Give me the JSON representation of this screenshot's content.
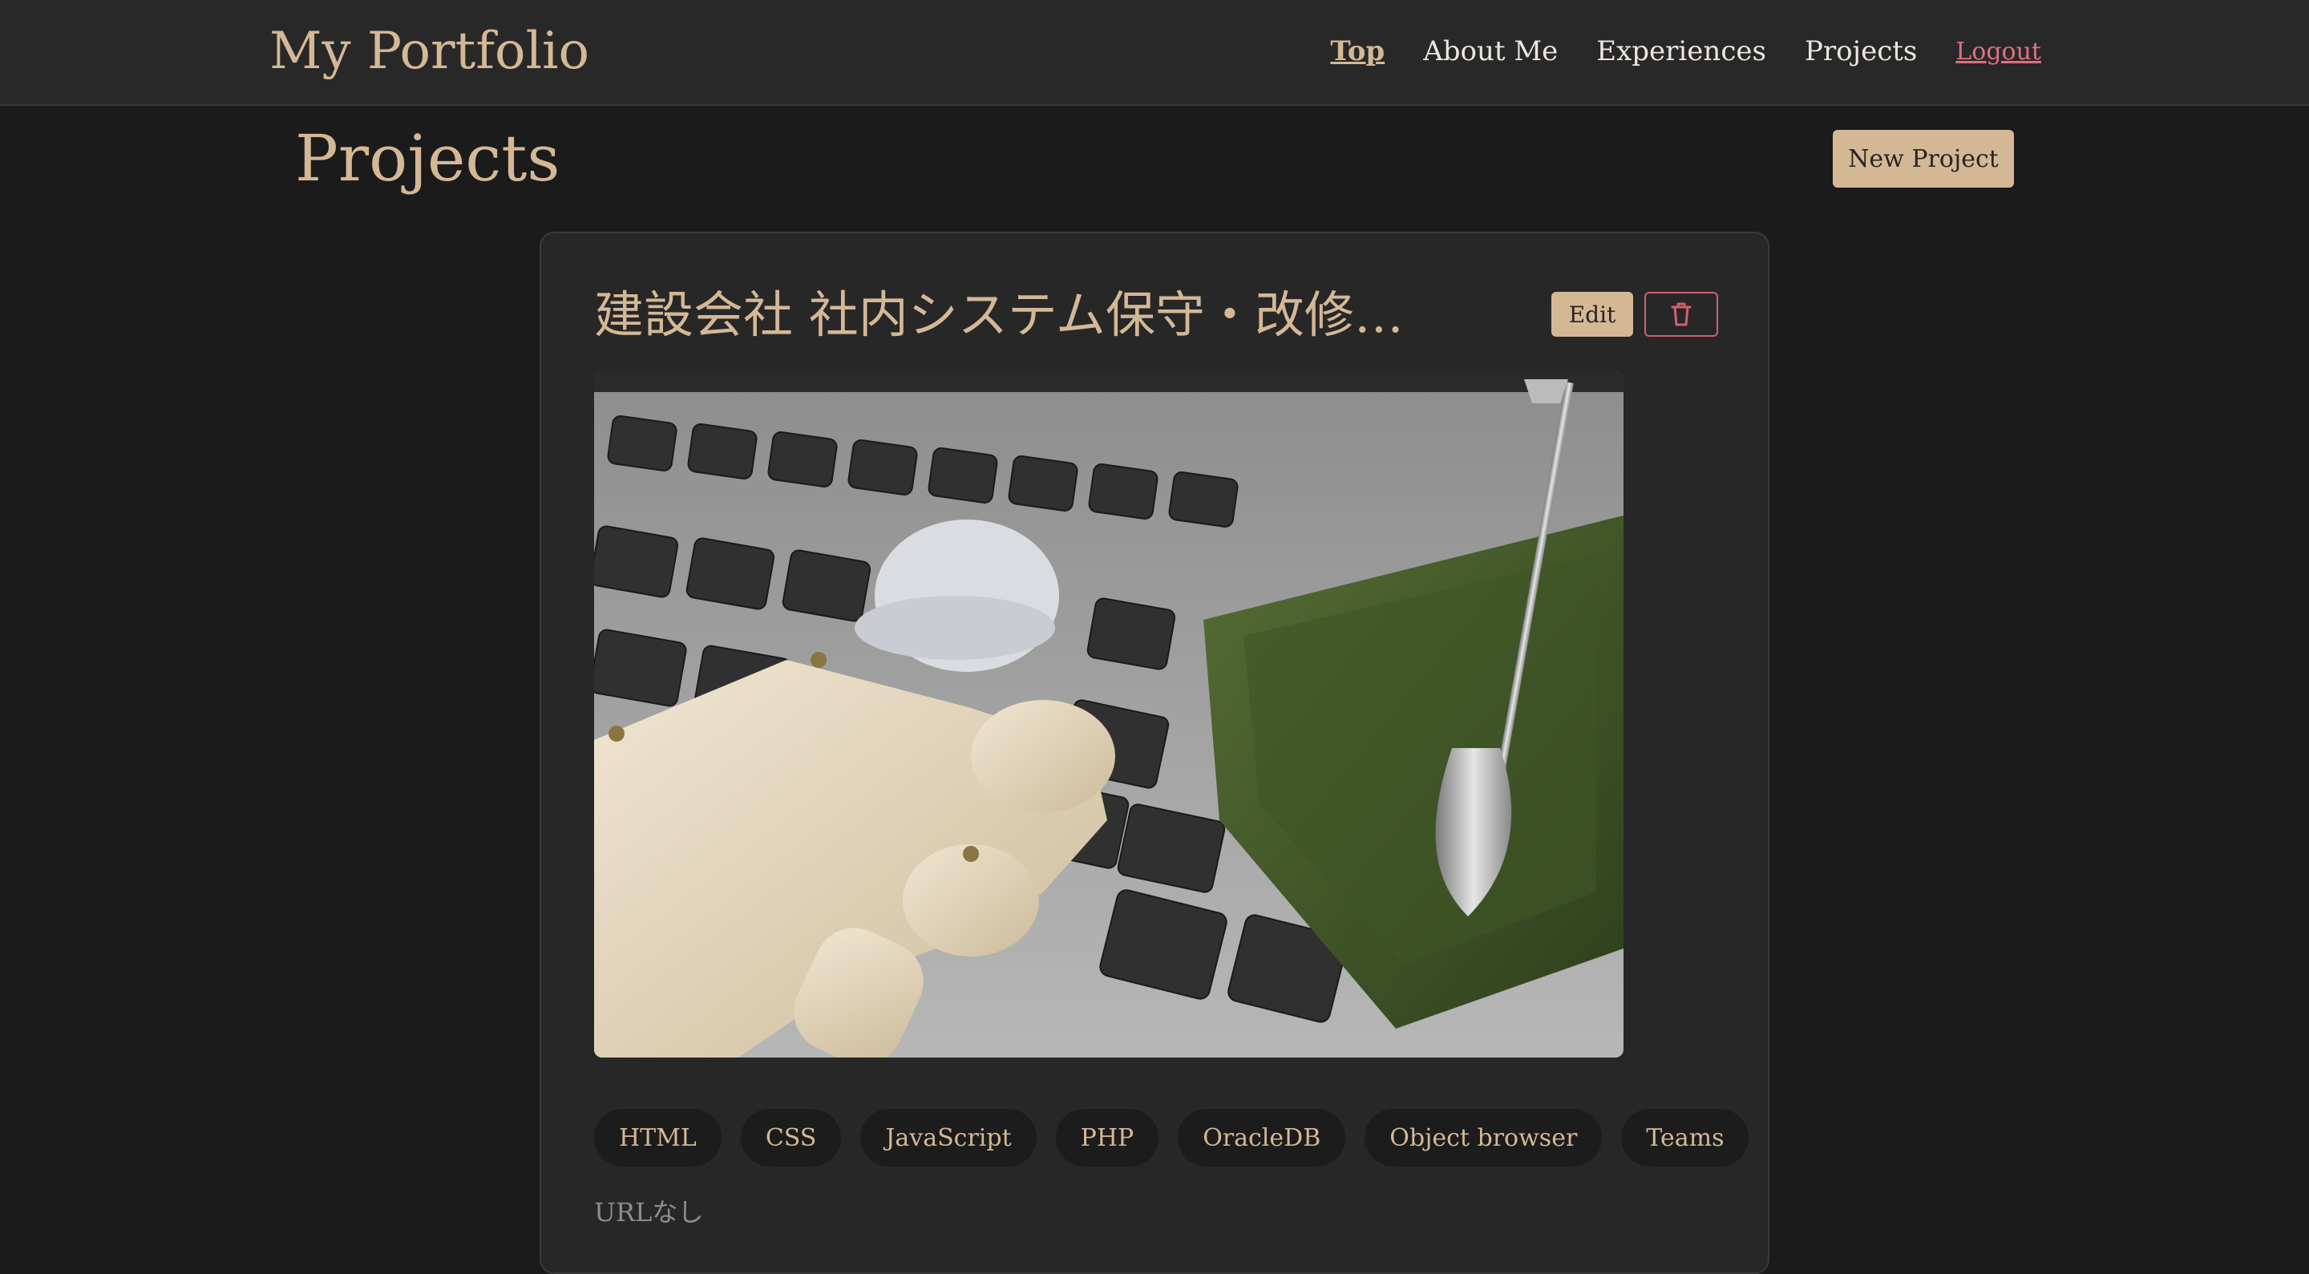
{
  "nav": {
    "brand": "My Portfolio",
    "links": [
      {
        "label": "Top",
        "active": true
      },
      {
        "label": "About Me"
      },
      {
        "label": "Experiences"
      },
      {
        "label": "Projects"
      },
      {
        "label": "Logout"
      }
    ]
  },
  "page": {
    "title": "Projects",
    "new_project_label": "New Project"
  },
  "project": {
    "title": "建設会社 社内システム保守・改修…",
    "edit_label": "Edit",
    "delete_icon": "trash-icon",
    "image_icon": "project-photo",
    "tags": [
      "HTML",
      "CSS",
      "JavaScript",
      "PHP",
      "OracleDB",
      "Object browser",
      "Teams"
    ],
    "url_text": "URLなし"
  },
  "colors": {
    "accent": "#d4b896",
    "background": "#1b1b1b",
    "card": "#272727",
    "danger": "#d06070"
  }
}
